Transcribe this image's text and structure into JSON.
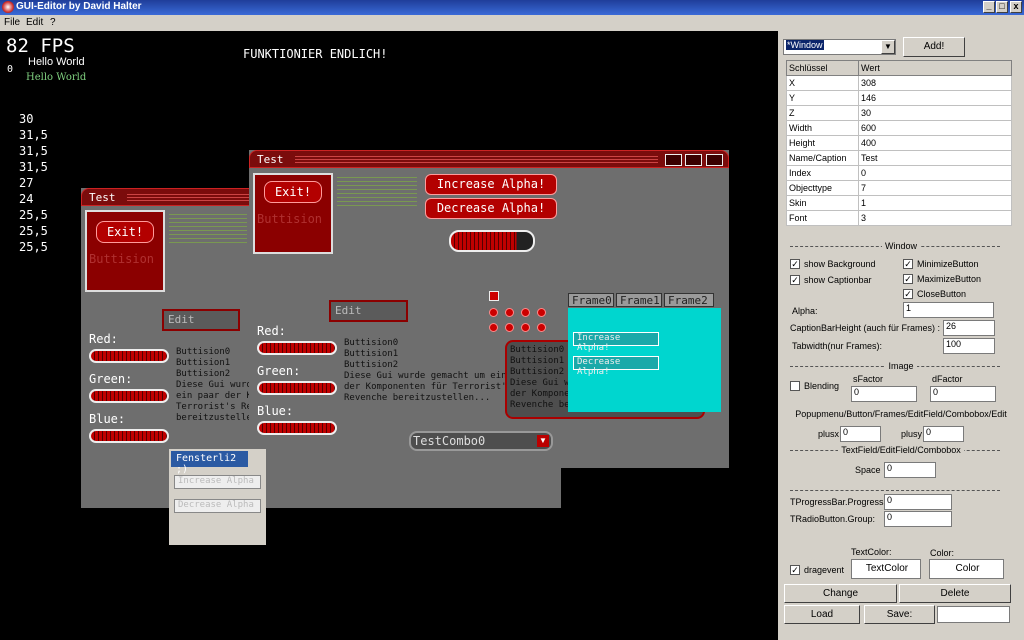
{
  "app": {
    "title": "GUI-Editor by David Halter",
    "min": "_",
    "max": "□",
    "close": "x"
  },
  "menu": [
    "File",
    "Edit",
    "?"
  ],
  "canvas": {
    "fps": "82 FPS",
    "zero": "0",
    "hello1": "Hello World",
    "hello2": "Hello World",
    "heading": "FUNKTIONIER ENDLICH!",
    "numbers": [
      "30",
      "31,5",
      "31,5",
      "31,5",
      "27",
      "24",
      "25,5",
      "25,5",
      "25,5"
    ]
  },
  "win1": {
    "caption": "Test",
    "exit": "Exit!",
    "buttision": "Buttision",
    "edit": "Edit",
    "red": "Red:",
    "green": "Green:",
    "blue": "Blue:",
    "text": "Buttision0\nButtision1\nButtision2\nDiese Gui wurde\nein paar der Ko\nTerrorist's Rev\nbereitzustellen"
  },
  "win2": {
    "caption": "Test",
    "exit": "Exit!",
    "buttision": "Buttision",
    "increase": "Increase Alpha!",
    "decrease": "Decrease Alpha!",
    "edit": "Edit",
    "red": "Red:",
    "green": "Green:",
    "blue": "Blue:",
    "text": "Buttision0\nButtision1\nButtision2\nDiese Gui wurde gemacht um ein paar\nder Komponenten für Terrorist's\nRevenche bereitzustellen...",
    "area_text": "Buttision0\nButtision1\nButtision2\nDiese Gui wurde gemacht um ein paar\nder Komponenten für Terrorist's\nRevenche bereitzustellen...",
    "combo": "TestCombo0",
    "tabs": [
      "Frame0",
      "Frame1",
      "Frame2"
    ],
    "frame_increase": "Increase Alpha!",
    "frame_decrease": "Decrease Alpha!"
  },
  "popup": {
    "title": "Fensterli2 ;)",
    "item1": "Increase Alpha",
    "item2": "Decrease Alpha"
  },
  "panel": {
    "type_select": "*Window",
    "add": "Add!",
    "table_head": [
      "Schlüssel",
      "Wert"
    ],
    "rows": [
      [
        "X",
        "308"
      ],
      [
        "Y",
        "146"
      ],
      [
        "Z",
        "30"
      ],
      [
        "Width",
        "600"
      ],
      [
        "Height",
        "400"
      ],
      [
        "Name/Caption",
        "Test"
      ],
      [
        "Index",
        "0"
      ],
      [
        "Objecttype",
        "7"
      ],
      [
        "Skin",
        "1"
      ],
      [
        "Font",
        "3"
      ]
    ],
    "sec_window": "Window",
    "show_background": "show Background",
    "show_captionbar": "show Captionbar",
    "minimize": "MinimizeButton",
    "maximize": "MaximizeButton",
    "closebtn": "CloseButton",
    "alpha_label": "Alpha:",
    "alpha": "1",
    "captionbarheight_label": "CaptionBarHeight (auch für Frames) :",
    "captionbarheight": "26",
    "tabwidth_label": "Tabwidth(nur Frames):",
    "tabwidth": "100",
    "sec_image": "Image",
    "blending": "Blending",
    "sfactor_label": "sFactor",
    "sfactor": "0",
    "dfactor_label": "dFactor",
    "dfactor": "0",
    "sec_popup": "Popupmenu/Button/Frames/EditField/Combobox/Edit",
    "plusx_label": "plusx",
    "plusx": "0",
    "plusy_label": "plusy",
    "plusy": "0",
    "sec_textfield": "TextField/EditField/Combobox",
    "space_label": "Space",
    "space": "0",
    "progress_label": "TProgressBar.Progress:",
    "progress": "0",
    "radio_label": "TRadioButton.Group:",
    "radio": "0",
    "textcolor_label": "TextColor:",
    "color_label": "Color:",
    "dragevent": "dragevent",
    "textcolor_btn": "TextColor",
    "color_btn": "Color",
    "change": "Change",
    "delete": "Delete",
    "load": "Load",
    "save": "Save:"
  }
}
